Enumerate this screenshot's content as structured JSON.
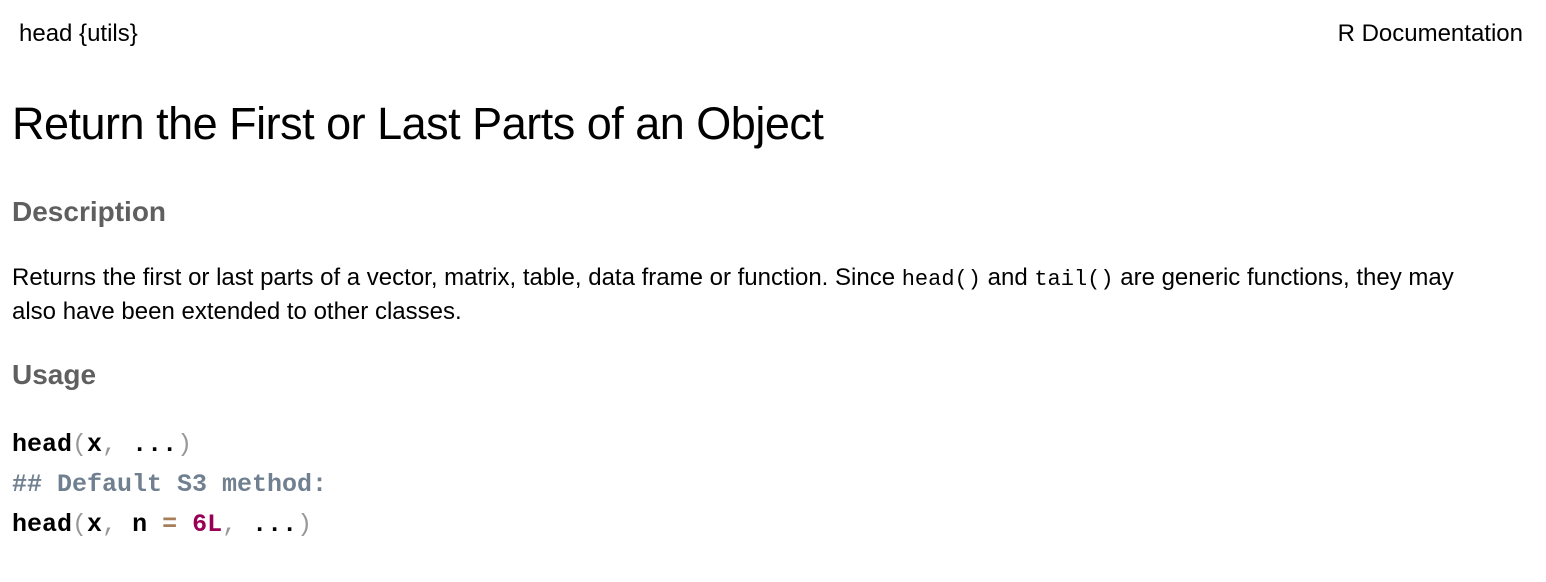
{
  "header": {
    "package": "head {utils}",
    "doc_label": "R Documentation"
  },
  "title": "Return the First or Last Parts of an Object",
  "description": {
    "heading": "Description",
    "text_1": "Returns the first or last parts of a vector, matrix, table, data frame or function. Since ",
    "code_1": "head()",
    "text_2": " and ",
    "code_2": "tail()",
    "text_3": " are generic functions, they may also have been extended to other classes."
  },
  "usage": {
    "heading": "Usage",
    "line1": {
      "fn": "head",
      "open": "(",
      "arg": "x",
      "comma": ",",
      "dots": " ...",
      "close": ")"
    },
    "comment": "## Default S3 method:",
    "line3": {
      "fn": "head",
      "open": "(",
      "arg1": "x",
      "comma1": ",",
      "arg2": " n ",
      "eq": "=",
      "val": " 6L",
      "comma2": ",",
      "dots": " ...",
      "close": ")"
    }
  },
  "colors": {
    "heading": "#5f5f5f",
    "comment": "#708090",
    "number": "#990055",
    "operator": "#a67f59",
    "punctuation": "#999999"
  }
}
